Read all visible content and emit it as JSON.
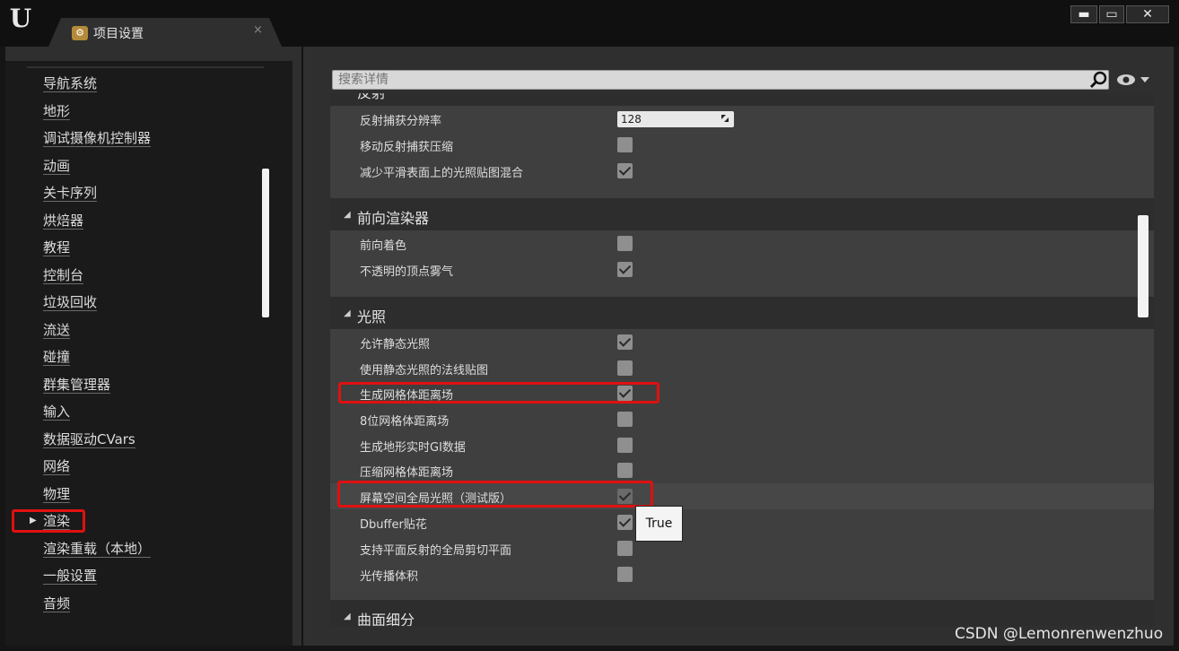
{
  "window": {
    "logo_text": "U",
    "tab_title": "项目设置",
    "tab_close": "×",
    "btn_min": "▬",
    "btn_max": "▭",
    "btn_close": "✕"
  },
  "sidebar": {
    "items": [
      "导航系统",
      "地形",
      "调试摄像机控制器",
      "动画",
      "关卡序列",
      "烘焙器",
      "教程",
      "控制台",
      "垃圾回收",
      "流送",
      "碰撞",
      "群集管理器",
      "输入",
      "数据驱动CVars",
      "网络",
      "物理",
      "渲染",
      "渲染重载（本地）",
      "一般设置",
      "音频"
    ],
    "selected": "渲染",
    "arrow": "▶"
  },
  "search": {
    "placeholder": "搜索详情"
  },
  "details": {
    "reflection": {
      "title_partial": "反射",
      "rows": [
        {
          "label": "反射捕获分辨率",
          "value": "128"
        },
        {
          "label": "移动反射捕获压缩",
          "checked": false
        },
        {
          "label": "减少平滑表面上的光照贴图混合",
          "checked": true
        }
      ]
    },
    "forward": {
      "title": "前向渲染器",
      "rows": [
        {
          "label": "前向着色",
          "checked": false
        },
        {
          "label": "不透明的顶点雾气",
          "checked": true
        }
      ]
    },
    "lighting": {
      "title": "光照",
      "rows": [
        {
          "label": "允许静态光照",
          "checked": true
        },
        {
          "label": "使用静态光照的法线贴图",
          "checked": false
        },
        {
          "label": "生成网格体距离场",
          "checked": true
        },
        {
          "label": "8位网格体距离场",
          "checked": false
        },
        {
          "label": "生成地形实时GI数据",
          "checked": false
        },
        {
          "label": "压缩网格体距离场",
          "checked": false
        },
        {
          "label": "屏幕空间全局光照（测试版）",
          "checked": true
        },
        {
          "label": "Dbuffer贴花",
          "checked": true
        },
        {
          "label": "支持平面反射的全局剪切平面",
          "checked": false
        },
        {
          "label": "光传播体积",
          "checked": false
        }
      ]
    },
    "tessellation": {
      "title": "曲面细分"
    }
  },
  "tooltip": {
    "text": "True"
  },
  "watermark": "CSDN @Lemonrenwenzhuo",
  "colors": {
    "highlight": "#e01010",
    "panel": "#3f3f3f",
    "background": "#1a1a1a"
  }
}
